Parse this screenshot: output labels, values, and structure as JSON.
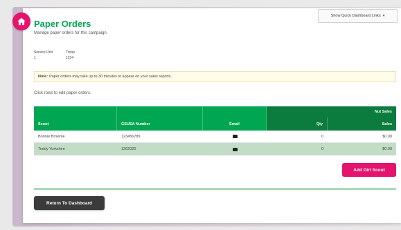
{
  "page": {
    "title": "Paper Orders",
    "subtitle": "Manage paper orders for this campaign."
  },
  "dashboard_button": {
    "label": "Show Quick Dashboard Links",
    "caret": "▾"
  },
  "meta": {
    "service_unit_label": "Service Unit",
    "service_unit_value": "1",
    "troop_label": "Troop",
    "troop_value": "1234"
  },
  "note": {
    "prefix": "Note:",
    "text": "Paper orders may take up to 30 minutes to appear on your sales reports."
  },
  "hint": "Click rows to edit paper orders.",
  "table": {
    "group_header": "Nut Sales",
    "columns": {
      "scout": "Scout",
      "gsusa": "GSUSA Number",
      "email": "Email",
      "qty": "Qty",
      "sales": "Sales"
    },
    "rows": [
      {
        "scout": "Bonnie Brownie",
        "gsusa": "123456789",
        "qty": "0",
        "sales": "$0.00"
      },
      {
        "scout": "Teddy Yorkshire",
        "gsusa": "1262020",
        "qty": "0",
        "sales": "$0.00"
      }
    ]
  },
  "buttons": {
    "add_scout": "Add Girl Scout",
    "return": "Return To Dashboard"
  },
  "colors": {
    "brand_green": "#00a651",
    "dark_green": "#0b7c3d",
    "accent_pink": "#e3136e"
  },
  "icons": {
    "home": "home-icon",
    "email": "envelope-icon"
  }
}
